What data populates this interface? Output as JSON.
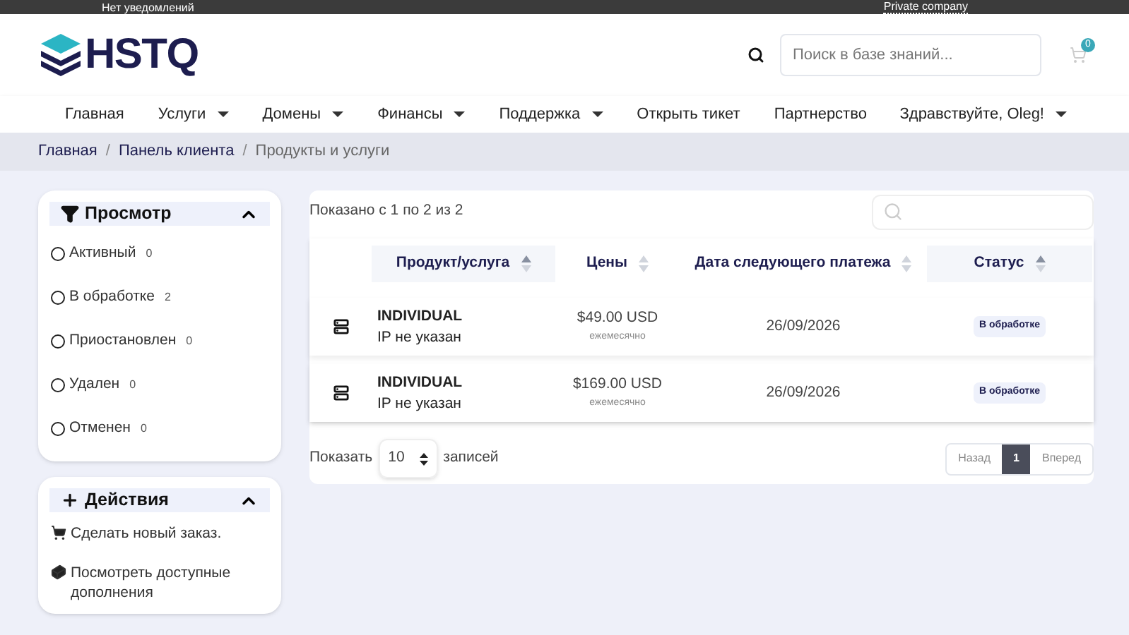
{
  "top_bar": {
    "notifications": "Нет уведомлений",
    "company": "Private company"
  },
  "header": {
    "logo": "HSTQ",
    "search": {
      "placeholder": "Поиск в базе знаний..."
    },
    "cart_count": "0"
  },
  "nav": {
    "items": [
      {
        "label": "Главная",
        "dropdown": false
      },
      {
        "label": "Услуги",
        "dropdown": true
      },
      {
        "label": "Домены",
        "dropdown": true
      },
      {
        "label": "Финансы",
        "dropdown": true
      },
      {
        "label": "Поддержка",
        "dropdown": true
      },
      {
        "label": "Открыть тикет",
        "dropdown": false
      },
      {
        "label": "Партнерство",
        "dropdown": false
      }
    ],
    "user": "Здравствуйте, Oleg!"
  },
  "breadcrumb": {
    "separator": "/",
    "items": [
      {
        "label": "Главная",
        "current": false
      },
      {
        "label": "Панель клиента",
        "current": false
      },
      {
        "label": "Продукты и услуги",
        "current": true
      }
    ]
  },
  "sidebar": {
    "view": {
      "title": "Просмотр",
      "expanded": true,
      "items": [
        {
          "label": "Активный",
          "count": "0",
          "checked": false
        },
        {
          "label": "В обработке",
          "count": "2",
          "checked": false
        },
        {
          "label": "Приостановлен",
          "count": "0",
          "checked": false
        },
        {
          "label": "Удален",
          "count": "0",
          "checked": false
        },
        {
          "label": "Отменен",
          "count": "0",
          "checked": false
        }
      ]
    },
    "actions": {
      "title": "Действия",
      "expanded": true,
      "items": [
        {
          "label": "Сделать новый заказ.",
          "kind": "cart"
        },
        {
          "label": "Посмотреть доступные дополнения",
          "kind": "addons"
        }
      ]
    }
  },
  "table": {
    "info": "Показано с 1 по 2 из 2",
    "columns": [
      {
        "label": "Продукт/услуга",
        "sorted": true
      },
      {
        "label": "Цены",
        "sorted": false
      },
      {
        "label": "Дата следующего платежа",
        "sorted": false
      },
      {
        "label": "Статус",
        "sorted": true
      }
    ],
    "rows": [
      {
        "product": "INDIVIDUAL",
        "ip": "IP не указан",
        "price": "$49.00 USD",
        "cycle": "ежемесячно",
        "date": "26/09/2026",
        "status": "В обработке"
      },
      {
        "product": "INDIVIDUAL",
        "ip": "IP не указан",
        "price": "$169.00 USD",
        "cycle": "ежемесячно",
        "date": "26/09/2026",
        "status": "В обработке"
      }
    ],
    "length": {
      "before": "Показать",
      "value": "10",
      "after": "записей"
    },
    "pagination": [
      {
        "label": "Назад",
        "selected": false
      },
      {
        "label": "1",
        "selected": true
      },
      {
        "label": "Вперед",
        "selected": false
      }
    ]
  }
}
